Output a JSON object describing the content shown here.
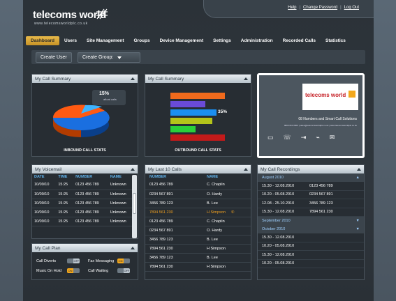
{
  "brand": {
    "name": "telecoms world",
    "url": "www.telecomsworldplc.co.uk",
    "accent": "#f3a81c"
  },
  "toplinks": [
    "Help",
    "Change Password",
    "Log Out"
  ],
  "nav": [
    "Dashboard",
    "Users",
    "Site Management",
    "Groups",
    "Device Management",
    "Settings",
    "Administration",
    "Recorded Calls",
    "Statistics"
  ],
  "toolbar": {
    "create_user": "Create User",
    "create_group": "Create Group:"
  },
  "summary1": {
    "title": "My Call Summary",
    "caption": "INBOUND CALL STATS",
    "pct_label": "15%",
    "pct_sub": "afloat calls"
  },
  "summary2": {
    "title": "My Call Summary",
    "caption": "OUTBOUND CALL STATS",
    "pct_label": "35%"
  },
  "ad": {
    "tagline": "08 Numbers and Smart Call Solutions",
    "contact": "0800 061 0600 | sales@telecomsworldplc.co.uk | www.telecomsworldplc.co.uk"
  },
  "voicemail": {
    "title": "My Voicemail",
    "headers": [
      "DATE",
      "TIME",
      "NUMBER",
      "NAME"
    ],
    "rows": [
      [
        "10/09/10",
        "15:25",
        "0123 456 789",
        "Unknown"
      ],
      [
        "10/09/10",
        "15:25",
        "0123 456 789",
        "Unknown"
      ],
      [
        "10/09/10",
        "15:25",
        "0123 456 789",
        "Unknown"
      ],
      [
        "10/09/10",
        "15:25",
        "0123 456 789",
        "Unknown"
      ],
      [
        "10/09/10",
        "15:25",
        "0123 456 789",
        "Unknown"
      ]
    ]
  },
  "callplan": {
    "title": "My Call Plan",
    "items": [
      {
        "label": "Call Diverts",
        "state": "OFF"
      },
      {
        "label": "Fax Messaging",
        "state": "ON"
      },
      {
        "label": "Music On Hold",
        "state": "ON"
      },
      {
        "label": "Call Waiting",
        "state": "OFF"
      }
    ]
  },
  "lastcalls": {
    "title": "My Last 10 Calls",
    "headers": [
      "NUMBER",
      "NAME"
    ],
    "rows": [
      [
        "0123 456 789",
        "C. Chaplin"
      ],
      [
        "0234 567 891",
        "O. Hardy"
      ],
      [
        "3456 789 123",
        "B. Lee"
      ],
      [
        "7894 561 230",
        "H Simpson"
      ],
      [
        "0123 456 789",
        "C. Chaplin"
      ],
      [
        "0234 567 891",
        "O. Hardy"
      ],
      [
        "3456 789 123",
        "B. Lee"
      ],
      [
        "7894 561 230",
        "H Simpson"
      ],
      [
        "3456 789 123",
        "B. Lee"
      ],
      [
        "7894 561 230",
        "H Simpson"
      ]
    ],
    "highlight_index": 3
  },
  "recordings": {
    "title": "My Call Recordings",
    "months": [
      {
        "name": "August 2010",
        "rows": [
          [
            "15.30 - 12.08.2010",
            "0123 456 789"
          ],
          [
            "10.20 - 05.08.2010",
            "0234 567 891"
          ],
          [
            "12.08 - 25.10.2010",
            "3456 789 123"
          ],
          [
            "15.30 - 12.08.2010",
            "7894 561 230"
          ]
        ]
      },
      {
        "name": "September 2010",
        "rows": []
      },
      {
        "name": "October 2010",
        "rows": [
          [
            "15.30 - 12.08.2010",
            ""
          ],
          [
            "10.20 - 05.08.2010",
            ""
          ],
          [
            "15.30 - 12.08.2010",
            ""
          ],
          [
            "10.20 - 05.08.2010",
            ""
          ]
        ]
      }
    ]
  }
}
